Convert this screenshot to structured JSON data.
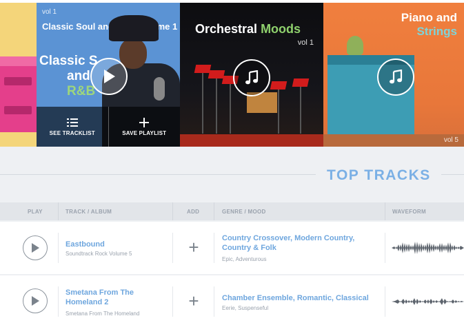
{
  "carousel": {
    "cards": [
      {
        "kind": "partial-left"
      },
      {
        "vol": "vol 1",
        "title": "Classic Soul and R&B Volume 1",
        "art_text": [
          "Classic S",
          "and",
          "R&B"
        ],
        "actions": [
          {
            "label": "SEE TRACKLIST",
            "icon": "list-icon"
          },
          {
            "label": "SAVE PLAYLIST",
            "icon": "plus-icon"
          }
        ],
        "button_icon": "play-icon"
      },
      {
        "title_part1": "Orchestral",
        "title_part2": "Moods",
        "vol": "vol 1",
        "button_icon": "music-note-icon"
      },
      {
        "title_line1": "Piano and",
        "title_line2": "Strings",
        "vol": "vol 5",
        "button_icon": "music-note-icon"
      }
    ]
  },
  "section": {
    "title": "TOP TRACKS"
  },
  "table": {
    "headers": {
      "play": "PLAY",
      "track": "TRACK / ALBUM",
      "add": "ADD",
      "genre": "GENRE / MOOD",
      "waveform": "WAVEFORM"
    },
    "rows": [
      {
        "title": "Eastbound",
        "album": "Soundtrack Rock Volume 5",
        "genre": "Country Crossover, Modern Country, Country & Folk",
        "mood": "Epic, Adventurous",
        "add": "+"
      },
      {
        "title": "Smetana From The Homeland 2",
        "album": "Smetana From The Homeland",
        "genre": "Chamber Ensemble, Romantic, Classical",
        "mood": "Eerie, Suspenseful",
        "add": "+"
      }
    ]
  },
  "colors": {
    "accent_blue": "#6ea6de",
    "accent_green": "#8fd16d",
    "heading_blue": "#7bb0e5"
  }
}
